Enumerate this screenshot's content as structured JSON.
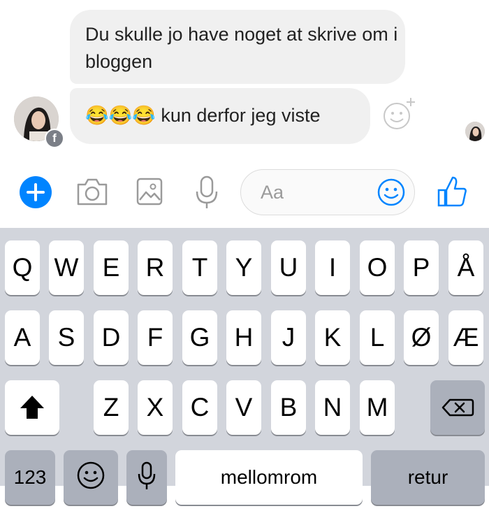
{
  "messages": [
    {
      "text": "Du skulle jo have noget at skrive om i bloggen"
    },
    {
      "text": "😂😂😂 kun derfor jeg viste"
    }
  ],
  "composer": {
    "placeholder": "Aa"
  },
  "keyboard": {
    "row1": [
      "Q",
      "W",
      "E",
      "R",
      "T",
      "Y",
      "U",
      "I",
      "O",
      "P",
      "Å"
    ],
    "row2": [
      "A",
      "S",
      "D",
      "F",
      "G",
      "H",
      "J",
      "K",
      "L",
      "Ø",
      "Æ"
    ],
    "row3": [
      "Z",
      "X",
      "C",
      "V",
      "B",
      "N",
      "M"
    ],
    "numbers_label": "123",
    "space_label": "mellomrom",
    "return_label": "retur"
  },
  "colors": {
    "accent": "#0084ff",
    "bubble": "#f0f0f0",
    "keyboard_bg": "#d2d5dc"
  }
}
